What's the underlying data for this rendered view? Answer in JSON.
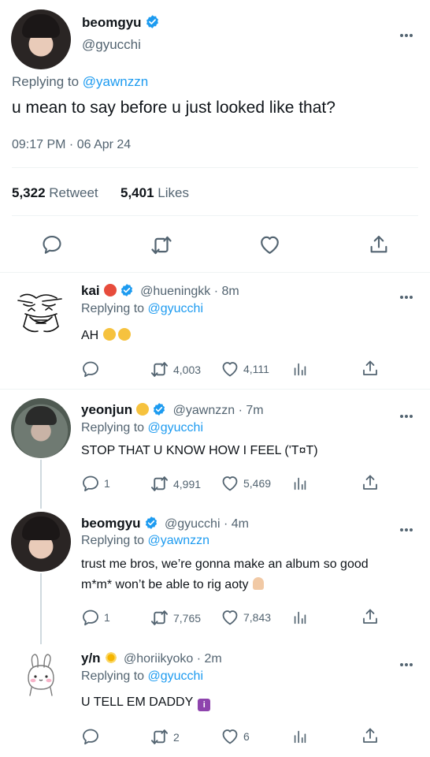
{
  "main": {
    "display_name": "beomgyu",
    "handle": "@gyucchi",
    "replying_prefix": "Replying to",
    "replying_to": "@yawnzzn",
    "text": "u mean to say before u just looked like that?",
    "timestamp": "09:17 PM · 06 Apr 24",
    "retweets_count": "5,322",
    "retweets_label": "Retweet",
    "likes_count": "5,401",
    "likes_label": "Likes"
  },
  "replies": [
    {
      "display_name": "kai",
      "handle": "@hueningkk",
      "time": "· 8m",
      "replying_prefix": "Replying to",
      "replying_to": "@gyucchi",
      "text": "AH",
      "reply_count": "",
      "retweet_count": "4,003",
      "like_count": "4,111"
    },
    {
      "display_name": "yeonjun",
      "handle": "@yawnzzn",
      "time": "· 7m",
      "replying_prefix": "Replying to",
      "replying_to": "@gyucchi",
      "text": "STOP THAT U KNOW HOW I FEEL ('T¤T)",
      "reply_count": "1",
      "retweet_count": "4,991",
      "like_count": "5,469"
    },
    {
      "display_name": "beomgyu",
      "handle": "@gyucchi",
      "time": "· 4m",
      "replying_prefix": "Replying to",
      "replying_to": "@yawnzzn",
      "text_line1": "trust me bros, we’re gonna make an album so good",
      "text_line2": "m*m* won’t be able to rig aoty",
      "reply_count": "1",
      "retweet_count": "7,765",
      "like_count": "7,843"
    },
    {
      "display_name": "y/n",
      "handle": "@horiikyoko",
      "time": "· 2m",
      "replying_prefix": "Replying to",
      "replying_to": "@gyucchi",
      "text": "U TELL EM DADDY",
      "reply_count": "",
      "retweet_count": "2",
      "like_count": "6"
    }
  ],
  "colors": {
    "accent": "#1d9bf0",
    "secondary_text": "#536471",
    "divider": "#eff3f4"
  }
}
